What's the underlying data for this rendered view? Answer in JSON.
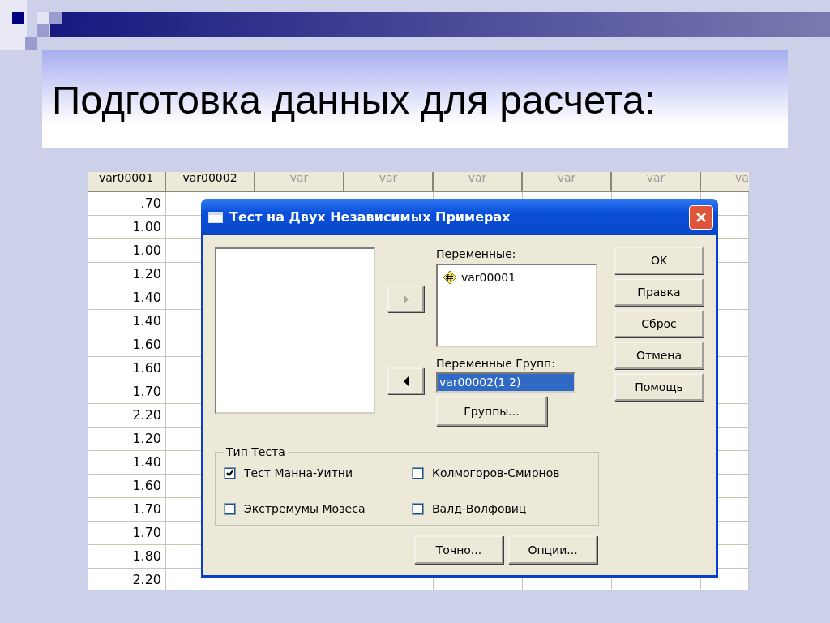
{
  "slide": {
    "title": "Подготовка данных для расчета:"
  },
  "spreadsheet": {
    "columns": [
      {
        "label": "var00001",
        "defined": true
      },
      {
        "label": "var00002",
        "defined": true
      },
      {
        "label": "var",
        "defined": false
      },
      {
        "label": "var",
        "defined": false
      },
      {
        "label": "var",
        "defined": false
      },
      {
        "label": "var",
        "defined": false
      },
      {
        "label": "var",
        "defined": false
      },
      {
        "label": "va",
        "defined": false
      }
    ],
    "rows": [
      [
        ".70"
      ],
      [
        "1.00"
      ],
      [
        "1.00"
      ],
      [
        "1.20"
      ],
      [
        "1.40"
      ],
      [
        "1.40"
      ],
      [
        "1.60"
      ],
      [
        "1.60"
      ],
      [
        "1.70"
      ],
      [
        "2.20"
      ],
      [
        "1.20"
      ],
      [
        "1.40"
      ],
      [
        "1.60"
      ],
      [
        "1.70"
      ],
      [
        "1.70"
      ],
      [
        "1.80"
      ],
      [
        "2.20"
      ]
    ]
  },
  "dialog": {
    "title": "Тест на Двух Независимых Примерах",
    "move_right_button": {
      "disabled": true
    },
    "move_left_button": {
      "disabled": false
    },
    "variables": {
      "label": "Переменные:",
      "items": [
        {
          "name": "var00001"
        }
      ]
    },
    "grouping": {
      "label": "Переменные Групп:",
      "value": "var00002(1 2)",
      "selected": true
    },
    "groups_button": "Группы...",
    "side_buttons": [
      "OK",
      "Правка",
      "Сброс",
      "Отмена",
      "Помощь"
    ],
    "test_type": {
      "label": "Тип Теста",
      "options": [
        {
          "label": "Тест Манна-Уитни",
          "checked": true
        },
        {
          "label": "Колмогоров-Смирнов",
          "checked": false
        },
        {
          "label": "Экстремумы Мозеса",
          "checked": false
        },
        {
          "label": "Валд-Волфовиц",
          "checked": false
        }
      ]
    },
    "bottom_buttons": [
      "Точно...",
      "Опции..."
    ]
  }
}
